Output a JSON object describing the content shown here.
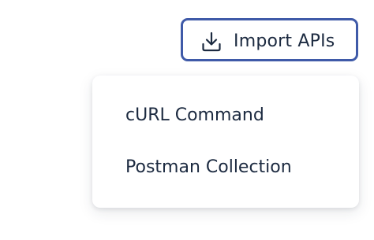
{
  "import_button": {
    "label": "Import APIs",
    "icon": "download-icon",
    "border_color": "#3f5aa8"
  },
  "dropdown": {
    "items": [
      {
        "label": "cURL Command"
      },
      {
        "label": "Postman Collection"
      }
    ]
  },
  "colors": {
    "text": "#1c2a40",
    "accent": "#3f5aa8"
  }
}
